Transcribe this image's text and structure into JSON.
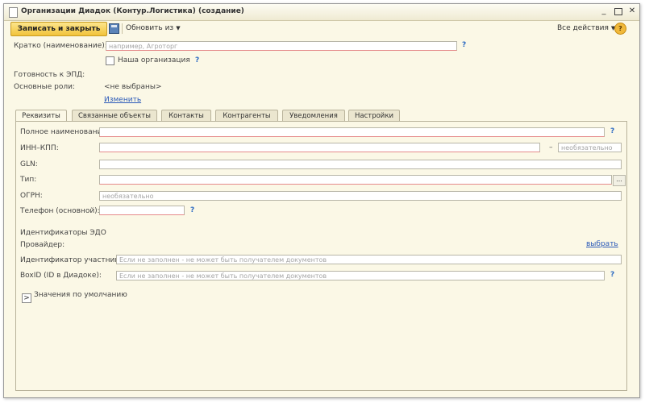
{
  "window": {
    "title": "Организации Диадок (Контур.Логистика) (создание)",
    "controls": {
      "minimize": "_",
      "close": "✕"
    }
  },
  "toolbar": {
    "save_close_label": "Записать и закрыть",
    "refresh_label": "Обновить из",
    "all_actions_label": "Все действия",
    "help_label": "?"
  },
  "header": {
    "short_name_label": "Кратко (наименование):",
    "short_name_value": "",
    "short_name_placeholder": "например, Агроторг",
    "our_org_label": "Наша организация",
    "our_org_checked": false,
    "edo_ready_label": "Готовность к ЭПД:",
    "main_roles_label": "Основные роли:",
    "main_roles_value": "<не выбраны>",
    "change_link": "Изменить",
    "help": "?"
  },
  "tabs": [
    {
      "label": "Реквизиты",
      "active": true
    },
    {
      "label": "Связанные объекты",
      "active": false
    },
    {
      "label": "Контакты",
      "active": false
    },
    {
      "label": "Контрагенты",
      "active": false
    },
    {
      "label": "Уведомления",
      "active": false
    },
    {
      "label": "Настройки",
      "active": false
    }
  ],
  "requisites": {
    "full_name_label": "Полное наименование:",
    "inn_kpp_label": "ИНН–КПП:",
    "kpp_placeholder": "необязательно",
    "dash": "–",
    "gln_label": "GLN:",
    "type_label": "Тип:",
    "type_button": "...",
    "ogrn_label": "ОГРН:",
    "ogrn_placeholder": "необязательно",
    "phone_label": "Телефон (основной):",
    "edo_section_label": "Идентификаторы ЭДО",
    "provider_label": "Провайдер:",
    "select_link": "выбрать",
    "participant_label": "Идентификатор участника:",
    "participant_placeholder": "Если не заполнен - не может быть получателем документов",
    "boxid_label": "BoxID (ID в Диадоке):",
    "boxid_placeholder": "Если не заполнен - не может быть получателем документов",
    "defaults_label": "Значения по умолчанию",
    "expander_glyph": ">"
  },
  "colors": {
    "window_bg": "#fbf8e6",
    "primary_button": "#f1c33a",
    "link": "#2a59b8",
    "required_underline": "#e58a8a"
  }
}
